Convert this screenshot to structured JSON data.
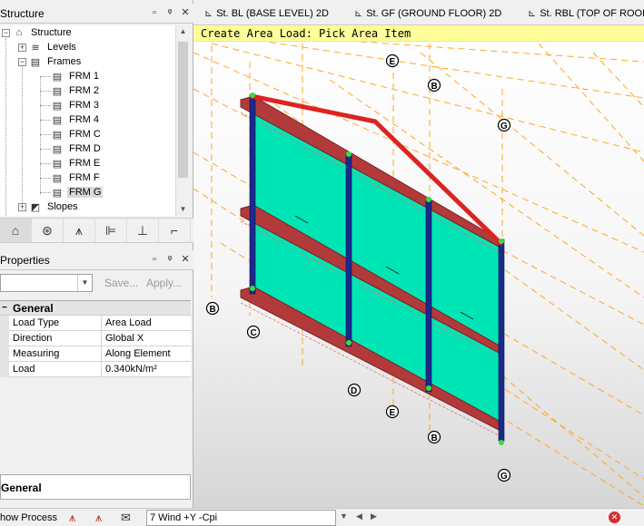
{
  "structure_panel": {
    "title": "Structure",
    "tree": {
      "root": "Structure",
      "levels": "Levels",
      "frames": "Frames",
      "frame_items": [
        "FRM 1",
        "FRM 2",
        "FRM 3",
        "FRM 4",
        "FRM C",
        "FRM D",
        "FRM E",
        "FRM F",
        "FRM G"
      ],
      "selected": "FRM G",
      "slopes": "Slopes"
    }
  },
  "properties_panel": {
    "title": "Properties",
    "save_label": "Save...",
    "apply_label": "Apply...",
    "category": "General",
    "rows": [
      {
        "key": "Load Type",
        "value": "Area Load"
      },
      {
        "key": "Direction",
        "value": "Global X"
      },
      {
        "key": "Measuring",
        "value": "Along Element"
      },
      {
        "key": "Load",
        "value": "0.340kN/m²"
      }
    ],
    "description_title": "General"
  },
  "tabs": [
    {
      "label": "St. BL (BASE LEVEL) 2D"
    },
    {
      "label": "St. GF (GROUND FLOOR) 2D"
    },
    {
      "label": "St. RBL (TOP OF ROOF"
    }
  ],
  "viewport": {
    "banner": "Create Area Load: Pick Area Item",
    "grid_labels": [
      "E",
      "B",
      "G",
      "B",
      "C",
      "D",
      "E",
      "B",
      "G"
    ]
  },
  "statusbar": {
    "process_label": "how Process",
    "load_case": "7 Wind +Y -Cpi"
  },
  "colors": {
    "panel_fill": "#00e5b5",
    "column": "#1a2a8c",
    "beam": "#b33a3a",
    "rafter": "#dd2222",
    "dashed_grid": "#ffa726",
    "banner": "#ffff99"
  }
}
